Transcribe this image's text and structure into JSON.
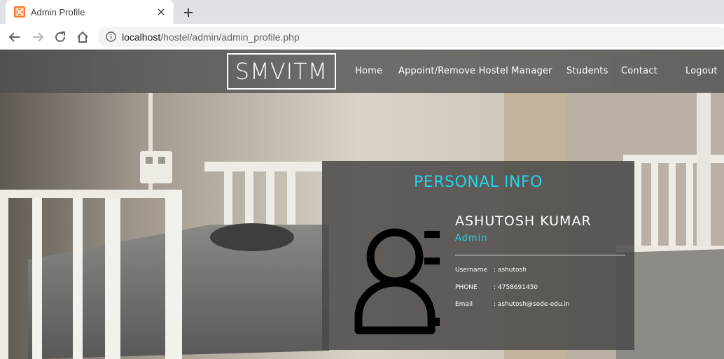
{
  "browser": {
    "tab_title": "Admin Profile",
    "url_host": "localhost",
    "url_path": "/hostel/admin/admin_profile.php",
    "favicon": "xampp-icon"
  },
  "site": {
    "brand": "SMVITM",
    "nav": [
      "Home",
      "Appoint/Remove Hostel Manager",
      "Students",
      "Contact",
      "Logout"
    ]
  },
  "profile": {
    "heading": "PERSONAL INFO",
    "name": "ASHUTOSH KUMAR",
    "role": "Admin",
    "fields": [
      {
        "label": "Username",
        "value": ": ashutosh"
      },
      {
        "label": "PHONE",
        "value": ": 4758691450"
      },
      {
        "label": "Email",
        "value": ": ashutosh@sode-edu.in"
      }
    ]
  },
  "colors": {
    "accent": "#22d3e8",
    "nav_bg": "#505050",
    "card_bg": "#4b4848"
  }
}
